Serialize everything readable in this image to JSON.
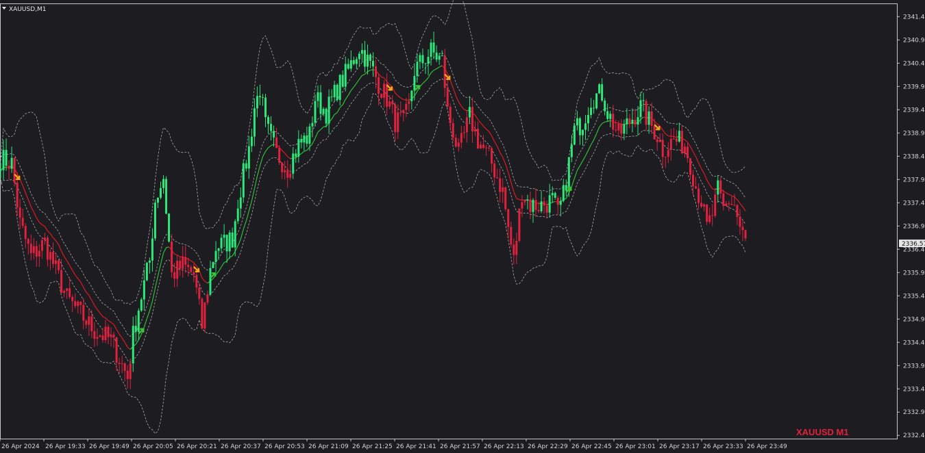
{
  "window": {
    "symbol_title": "XAUUSD,M1",
    "watermark": "XAUUSD M1"
  },
  "colors": {
    "background": "#1c1c21",
    "frame": "#c8c8c8",
    "bull": "#2ee87a",
    "bear": "#e0223f",
    "ma_up": "#2fbf3a",
    "ma_down": "#e01b24",
    "band": "#cfcfcf",
    "sell_arrow": "#f4a41d",
    "buy_arrow": "#39c23a"
  },
  "icons": {
    "title_dropdown": "triangle-down-icon",
    "sell_signal": "arrow-down-right-icon",
    "buy_signal": "arrow-up-right-icon"
  },
  "chart_data": {
    "type": "candlestick",
    "ylim": [
      2332.38,
      2341.72
    ],
    "y_ticks": [
      "2341.45",
      "2340.95",
      "2340.45",
      "2339.95",
      "2339.45",
      "2338.95",
      "2338.45",
      "2337.95",
      "2337.45",
      "2336.95",
      "2336.45",
      "2335.95",
      "2335.45",
      "2334.95",
      "2334.45",
      "2333.95",
      "2333.45",
      "2332.95",
      "2332.45"
    ],
    "current_price": "2336.57",
    "x_ticks": [
      "26 Apr 2024",
      "26 Apr 19:33",
      "26 Apr 19:49",
      "26 Apr 20:05",
      "26 Apr 20:21",
      "26 Apr 20:37",
      "26 Apr 20:53",
      "26 Apr 21:09",
      "26 Apr 21:25",
      "26 Apr 21:41",
      "26 Apr 21:57",
      "26 Apr 22:13",
      "26 Apr 22:29",
      "26 Apr 22:45",
      "26 Apr 23:01",
      "26 Apr 23:17",
      "26 Apr 23:33",
      "26 Apr 23:49"
    ],
    "bar_count": 271,
    "price_path": [
      [
        0,
        2338.4
      ],
      [
        4,
        2338.3
      ],
      [
        7,
        2337.0
      ],
      [
        11,
        2336.3
      ],
      [
        16,
        2336.6
      ],
      [
        24,
        2335.4
      ],
      [
        34,
        2334.7
      ],
      [
        40,
        2334.5
      ],
      [
        46,
        2333.7
      ],
      [
        48,
        2334.6
      ],
      [
        50,
        2335.2
      ],
      [
        54,
        2336.2
      ],
      [
        56,
        2337.5
      ],
      [
        59,
        2338.0
      ],
      [
        62,
        2335.9
      ],
      [
        66,
        2336.1
      ],
      [
        70,
        2335.9
      ],
      [
        73,
        2334.8
      ],
      [
        76,
        2336.0
      ],
      [
        78,
        2336.5
      ],
      [
        82,
        2336.6
      ],
      [
        84,
        2336.7
      ],
      [
        86,
        2337.5
      ],
      [
        90,
        2338.6
      ],
      [
        92,
        2339.5
      ],
      [
        94,
        2339.9
      ],
      [
        96,
        2339.1
      ],
      [
        100,
        2338.5
      ],
      [
        104,
        2338.2
      ],
      [
        108,
        2338.7
      ],
      [
        112,
        2338.9
      ],
      [
        114,
        2339.7
      ],
      [
        118,
        2339.4
      ],
      [
        122,
        2339.9
      ],
      [
        126,
        2340.3
      ],
      [
        130,
        2340.8
      ],
      [
        134,
        2340.4
      ],
      [
        138,
        2339.9
      ],
      [
        140,
        2339.7
      ],
      [
        143,
        2339.2
      ],
      [
        146,
        2339.2
      ],
      [
        148,
        2339.5
      ],
      [
        150,
        2340.3
      ],
      [
        153,
        2340.5
      ],
      [
        156,
        2340.7
      ],
      [
        160,
        2340.5
      ],
      [
        161,
        2340.0
      ],
      [
        162,
        2339.4
      ],
      [
        164,
        2339.0
      ],
      [
        166,
        2338.5
      ],
      [
        170,
        2339.3
      ],
      [
        173,
        2338.8
      ],
      [
        178,
        2338.3
      ],
      [
        182,
        2337.7
      ],
      [
        184,
        2336.9
      ],
      [
        186,
        2336.2
      ],
      [
        189,
        2337.7
      ],
      [
        192,
        2337.4
      ],
      [
        196,
        2337.4
      ],
      [
        200,
        2337.5
      ],
      [
        202,
        2337.2
      ],
      [
        204,
        2337.6
      ],
      [
        206,
        2338.3
      ],
      [
        208,
        2339.0
      ],
      [
        211,
        2339.2
      ],
      [
        214,
        2339.7
      ],
      [
        218,
        2339.8
      ],
      [
        220,
        2339.4
      ],
      [
        224,
        2338.9
      ],
      [
        228,
        2339.2
      ],
      [
        232,
        2339.5
      ],
      [
        234,
        2339.3
      ],
      [
        236,
        2339.1
      ],
      [
        238,
        2338.9
      ],
      [
        240,
        2338.6
      ],
      [
        244,
        2338.8
      ],
      [
        248,
        2338.7
      ],
      [
        250,
        2338.3
      ],
      [
        252,
        2337.8
      ],
      [
        254,
        2337.5
      ],
      [
        256,
        2336.9
      ],
      [
        258,
        2337.2
      ],
      [
        260,
        2337.7
      ],
      [
        262,
        2337.3
      ],
      [
        264,
        2337.5
      ],
      [
        266,
        2337.4
      ],
      [
        268,
        2336.9
      ],
      [
        270,
        2336.6
      ]
    ],
    "signals": [
      {
        "bar": 6,
        "type": "sell"
      },
      {
        "bar": 51,
        "type": "buy"
      },
      {
        "bar": 71,
        "type": "sell"
      },
      {
        "bar": 77,
        "type": "buy"
      },
      {
        "bar": 141,
        "type": "sell"
      },
      {
        "bar": 151,
        "type": "buy"
      },
      {
        "bar": 162,
        "type": "sell"
      },
      {
        "bar": 206,
        "type": "buy"
      },
      {
        "bar": 238,
        "type": "sell"
      }
    ]
  }
}
